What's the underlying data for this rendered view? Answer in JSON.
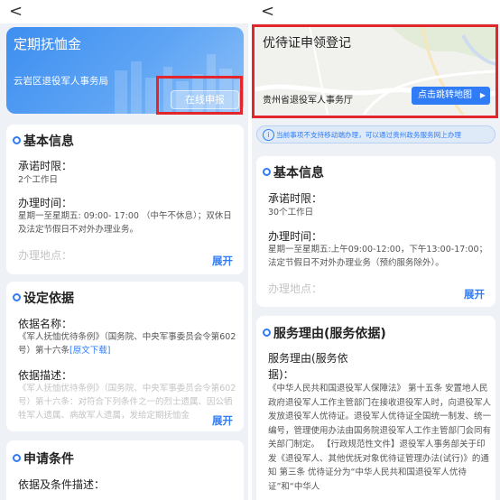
{
  "left": {
    "back_symbol": "<",
    "banner": {
      "title": "定期抚恤金",
      "department": "云岩区退役军人事务局",
      "apply_button": "在线申报"
    },
    "basic_info": {
      "title": "基本信息",
      "promise_label": "承诺时限：",
      "promise_value": "2个工作日",
      "hours_label": "办理时间：",
      "hours_value": "星期一至星期五: 09:00- 17:00 （中午不休息）；双休日及法定节假日不对外办理业务。",
      "location_label": "办理地点：",
      "expand": "展开"
    },
    "basis": {
      "title": "设定依据",
      "name_label": "依据名称：",
      "name_value": "《军人抚恤优待条例》（国务院、中央军事委员会令第602号）第十六条",
      "name_link": "[原文下载]",
      "desc_label": "依据描述：",
      "desc_value": "《军人抚恤优待条例》（国务院、中央军事委员会令第602号）第十六条：对符合下列条件之一的烈士遗属、因公牺牲军人遗属、病故军人遗属，发给定期抚恤金",
      "expand": "展开"
    },
    "conditions": {
      "title": "申请条件",
      "desc_label": "依据及条件描述："
    }
  },
  "right": {
    "back_symbol": "<",
    "banner": {
      "title": "优待证申领登记",
      "department": "贵州省退役军人事务厅",
      "map_button": "点击跳转地图"
    },
    "notice": "当前事项不支持移动端办理，可以通过贵州政务服务网上办理",
    "basic_info": {
      "title": "基本信息",
      "promise_label": "承诺时限：",
      "promise_value": "30个工作日",
      "hours_label": "办理时间：",
      "hours_value": "星期一至星期五:上午09:00-12:00，下午13:00-17:00；法定节假日不对外办理业务（预约服务除外）。",
      "location_label": "办理地点：",
      "expand": "展开"
    },
    "service": {
      "title": "服务理由(服务依据)",
      "reason_label_line1": "服务理由(服务依",
      "reason_label_line2": "据)：",
      "reason_value": "《中华人民共和国退役军人保障法》 第十五条 安置地人民政府退役军人工作主管部门在接收退役军人时，向退役军人发放退役军人优待证。退役军人优待证全国统一制发、统一编号，管理使用办法由国务院退役军人工作主管部门会同有关部门制定。 【行政规范性文件】退役军人事务部关于印发《退役军人、其他优抚对象优待证管理办法(试行)》的通知 第三条 优待证分为“中华人民共和国退役军人优待证”和“中华人"
    }
  },
  "colors": {
    "accent": "#2f7cf6",
    "highlight_box": "#e3262b",
    "banner_gradient_start": "#3d8ef0",
    "banner_gradient_end": "#8ec0f7"
  }
}
